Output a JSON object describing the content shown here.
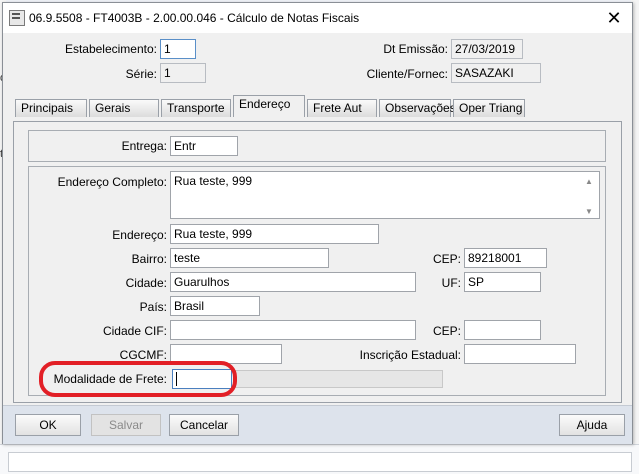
{
  "window": {
    "title": "06.9.5508 - FT4003B - 2.00.00.046 - Cálculo de Notas Fiscais",
    "close_glyph": "✕"
  },
  "header": {
    "estabelecimento_label": "Estabelecimento:",
    "estabelecimento_value": "1",
    "serie_label": "Série:",
    "serie_value": "1",
    "dt_emissao_label": "Dt Emissão:",
    "dt_emissao_value": "27/03/2019",
    "cliente_label": "Cliente/Fornec:",
    "cliente_value": "SASAZAKI"
  },
  "tabs": [
    {
      "label": "Principais"
    },
    {
      "label": "Gerais"
    },
    {
      "label": "Transporte"
    },
    {
      "label": "Endereço"
    },
    {
      "label": "Frete Aut"
    },
    {
      "label": "Observações"
    },
    {
      "label": "Oper Triang"
    }
  ],
  "active_tab": "Endereço",
  "form": {
    "entrega_label": "Entrega:",
    "entrega_value": "Entr",
    "endereco_completo_label": "Endereço Completo:",
    "endereco_completo_value": "Rua teste, 999",
    "endereco_label": "Endereço:",
    "endereco_value": "Rua teste, 999",
    "bairro_label": "Bairro:",
    "bairro_value": "teste",
    "cep_label": "CEP:",
    "cep_value": "89218001",
    "cidade_label": "Cidade:",
    "cidade_value": "Guarulhos",
    "uf_label": "UF:",
    "uf_value": "SP",
    "pais_label": "País:",
    "pais_value": "Brasil",
    "cidade_cif_label": "Cidade CIF:",
    "cidade_cif_value": "",
    "cep_cif_label": "CEP:",
    "cep_cif_value": "",
    "cgcmf_label": "CGCMF:",
    "cgcmf_value": "",
    "inscricao_label": "Inscrição Estadual:",
    "inscricao_value": "",
    "modalidade_label": "Modalidade de Frete:",
    "modalidade_value": "",
    "modalidade_desc": ""
  },
  "buttons": {
    "ok": "OK",
    "salvar": "Salvar",
    "cancelar": "Cancelar",
    "ajuda": "Ajuda"
  },
  "background_fragments": {
    "left_o": "o",
    "left_t": "t"
  },
  "colors": {
    "annotation": "#e21f26",
    "footer": "#dde3ec"
  }
}
